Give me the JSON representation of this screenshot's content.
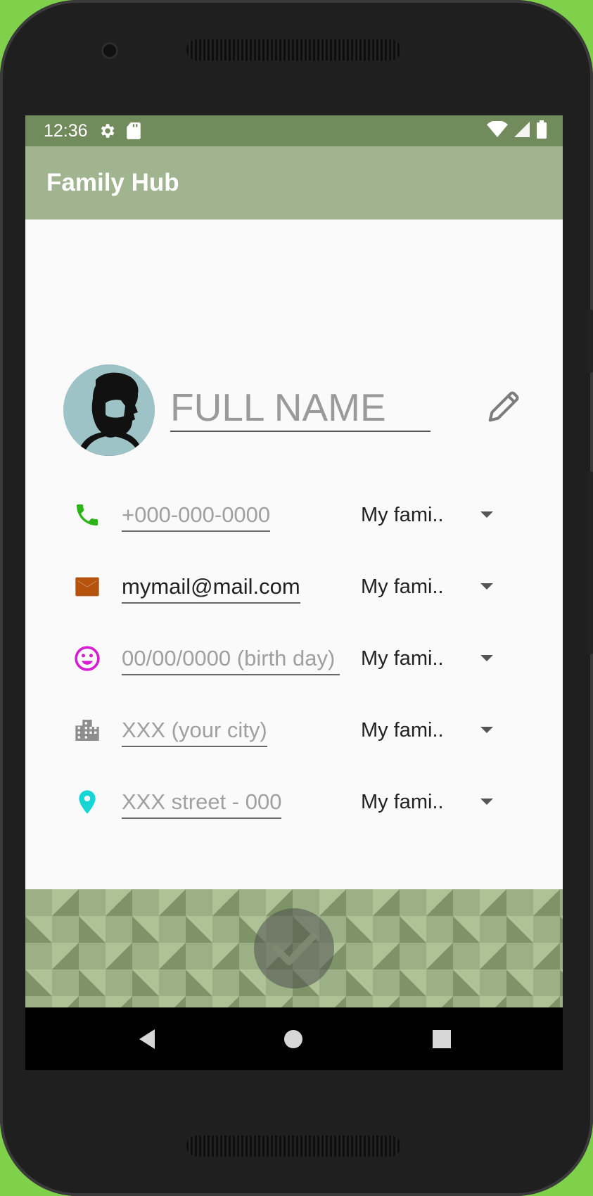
{
  "status_bar": {
    "time": "12:36",
    "icons": [
      "gear-icon",
      "sd-card-icon",
      "wifi-icon",
      "signal-icon",
      "battery-icon"
    ]
  },
  "app_bar": {
    "title": "Family Hub"
  },
  "profile": {
    "name_placeholder": "FULL NAME",
    "avatar": "bearded-man-avatar",
    "edit_icon": "pencil-icon"
  },
  "fields": [
    {
      "icon": "phone-icon",
      "icon_color": "#2bb416",
      "value": "",
      "placeholder": "+000-000-0000",
      "visibility": "My fami.."
    },
    {
      "icon": "email-icon",
      "icon_color": "#b5530e",
      "value": "mymail@mail.com",
      "placeholder": "",
      "visibility": "My fami.."
    },
    {
      "icon": "smiley-icon",
      "icon_color": "#d51ed0",
      "value": "",
      "placeholder": "00/00/0000 (birth day)",
      "visibility": "My fami.."
    },
    {
      "icon": "city-icon",
      "icon_color": "#8d8d8d",
      "value": "",
      "placeholder": "XXX (your city)",
      "visibility": "My fami.."
    },
    {
      "icon": "location-pin-icon",
      "icon_color": "#16d5d5",
      "value": "",
      "placeholder": "XXX street - 000",
      "visibility": "My fami.."
    }
  ],
  "confirm": {
    "icon": "checkmark-icon"
  },
  "nav_bar": {
    "icons": [
      "back-icon",
      "home-icon",
      "recents-icon"
    ]
  },
  "colors": {
    "status_bar": "#728b5c",
    "app_bar": "#a0b48f",
    "background": "#7fd04a"
  }
}
